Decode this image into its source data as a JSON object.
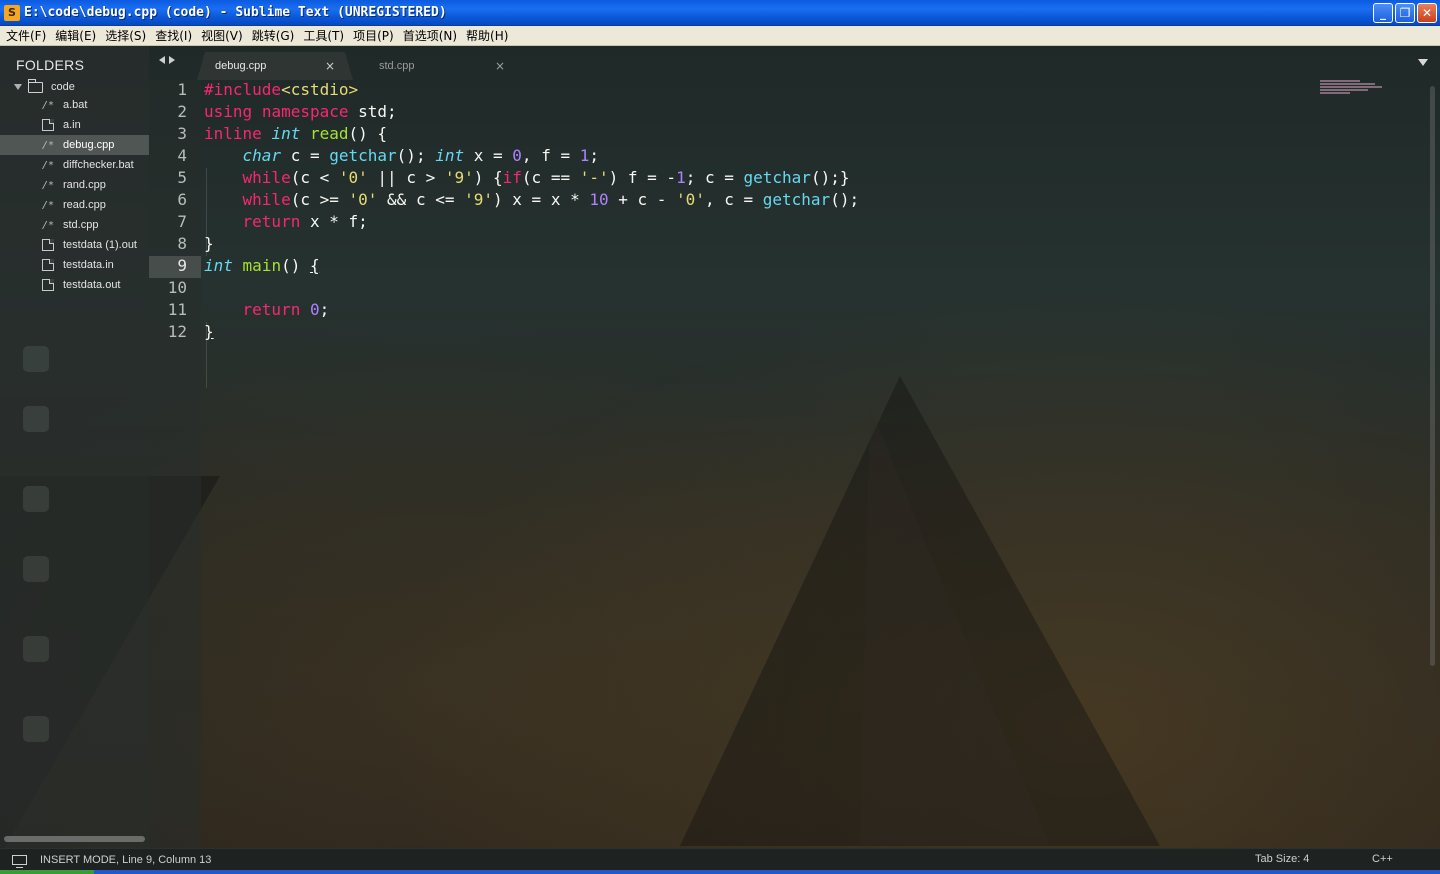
{
  "window": {
    "title": "E:\\code\\debug.cpp (code) - Sublime Text (UNREGISTERED)",
    "minimize": "_",
    "maximize": "❐",
    "close": "✕"
  },
  "menu": [
    "文件(F)",
    "编辑(E)",
    "选择(S)",
    "查找(I)",
    "视图(V)",
    "跳转(G)",
    "工具(T)",
    "项目(P)",
    "首选项(N)",
    "帮助(H)"
  ],
  "sidebar": {
    "header": "FOLDERS",
    "root": "code",
    "files": [
      {
        "name": "a.bat",
        "icon": "code-file-icon"
      },
      {
        "name": "a.in",
        "icon": "doc-file-icon"
      },
      {
        "name": "debug.cpp",
        "icon": "code-file-icon",
        "active": true
      },
      {
        "name": "diffchecker.bat",
        "icon": "code-file-icon"
      },
      {
        "name": "rand.cpp",
        "icon": "code-file-icon"
      },
      {
        "name": "read.cpp",
        "icon": "code-file-icon"
      },
      {
        "name": "std.cpp",
        "icon": "code-file-icon"
      },
      {
        "name": "testdata (1).out",
        "icon": "doc-file-icon"
      },
      {
        "name": "testdata.in",
        "icon": "doc-file-icon"
      },
      {
        "name": "testdata.out",
        "icon": "doc-file-icon"
      }
    ]
  },
  "tabs": [
    {
      "label": "debug.cpp",
      "active": true
    },
    {
      "label": "std.cpp",
      "active": false
    }
  ],
  "tab_close_glyph": "×",
  "editor": {
    "current_line": 9,
    "lines": [
      [
        [
          "kw",
          "#include"
        ],
        [
          "str",
          "<cstdio>"
        ]
      ],
      [
        [
          "kw",
          "using"
        ],
        [
          "op",
          " "
        ],
        [
          "kw",
          "namespace"
        ],
        [
          "op",
          " std;"
        ]
      ],
      [
        [
          "kw",
          "inline"
        ],
        [
          "op",
          " "
        ],
        [
          "type",
          "int"
        ],
        [
          "op",
          " "
        ],
        [
          "fn",
          "read"
        ],
        [
          "op",
          "() {"
        ]
      ],
      [
        [
          "op",
          "    "
        ],
        [
          "type",
          "char"
        ],
        [
          "op",
          " c = "
        ],
        [
          "call",
          "getchar"
        ],
        [
          "op",
          "(); "
        ],
        [
          "type",
          "int"
        ],
        [
          "op",
          " x = "
        ],
        [
          "num",
          "0"
        ],
        [
          "op",
          ", f = "
        ],
        [
          "num",
          "1"
        ],
        [
          "op",
          ";"
        ]
      ],
      [
        [
          "op",
          "    "
        ],
        [
          "kw",
          "while"
        ],
        [
          "op",
          "(c < "
        ],
        [
          "str",
          "'0'"
        ],
        [
          "op",
          " || c > "
        ],
        [
          "str",
          "'9'"
        ],
        [
          "op",
          ") {"
        ],
        [
          "kw",
          "if"
        ],
        [
          "op",
          "(c == "
        ],
        [
          "str",
          "'-'"
        ],
        [
          "op",
          ") f = -"
        ],
        [
          "num",
          "1"
        ],
        [
          "op",
          "; c = "
        ],
        [
          "call",
          "getchar"
        ],
        [
          "op",
          "();}"
        ]
      ],
      [
        [
          "op",
          "    "
        ],
        [
          "kw",
          "while"
        ],
        [
          "op",
          "(c >= "
        ],
        [
          "str",
          "'0'"
        ],
        [
          "op",
          " && c <= "
        ],
        [
          "str",
          "'9'"
        ],
        [
          "op",
          ") x = x * "
        ],
        [
          "num",
          "10"
        ],
        [
          "op",
          " + c - "
        ],
        [
          "str",
          "'0'"
        ],
        [
          "op",
          ", c = "
        ],
        [
          "call",
          "getchar"
        ],
        [
          "op",
          "();"
        ]
      ],
      [
        [
          "op",
          "    "
        ],
        [
          "kw",
          "return"
        ],
        [
          "op",
          " x * f;"
        ]
      ],
      [
        [
          "op",
          "}"
        ]
      ],
      [
        [
          "type",
          "int"
        ],
        [
          "op",
          " "
        ],
        [
          "fn",
          "main"
        ],
        [
          "op",
          "() "
        ],
        [
          "bracket",
          "{"
        ]
      ],
      [
        [
          "op",
          ""
        ]
      ],
      [
        [
          "op",
          "    "
        ],
        [
          "kw",
          "return"
        ],
        [
          "op",
          " "
        ],
        [
          "num",
          "0"
        ],
        [
          "op",
          ";"
        ]
      ],
      [
        [
          "bracket",
          "}"
        ]
      ]
    ],
    "line_numbers": [
      "1",
      "2",
      "3",
      "4",
      "5",
      "6",
      "7",
      "8",
      "9",
      "10",
      "11",
      "12"
    ]
  },
  "status": {
    "mode": "INSERT MODE, Line 9, Column 13",
    "tab_size": "Tab Size: 4",
    "syntax": "C++"
  },
  "colors": {
    "keyword": "#f92672",
    "type": "#66d9ef",
    "function": "#a6e22e",
    "string": "#e6db74",
    "number": "#ae81ff",
    "titlebar": "#0a5be0"
  }
}
